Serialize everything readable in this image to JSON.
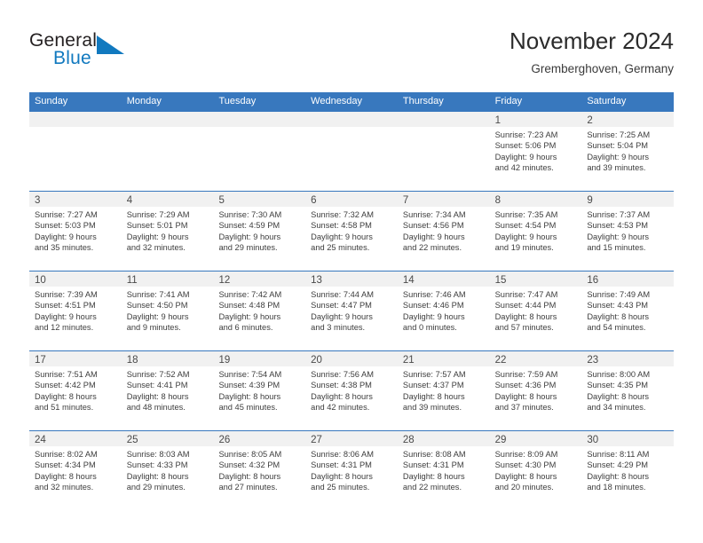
{
  "brand": {
    "name_part1": "General",
    "name_part2": "Blue",
    "accent_color": "#1179bf"
  },
  "header": {
    "title": "November 2024",
    "location": "Gremberghoven, Germany"
  },
  "theme": {
    "header_blue": "#3878be",
    "day_band_gray": "#f1f1f1",
    "text_color": "#3d3d3d"
  },
  "weekdays": [
    "Sunday",
    "Monday",
    "Tuesday",
    "Wednesday",
    "Thursday",
    "Friday",
    "Saturday"
  ],
  "weeks": [
    [
      {
        "day": "",
        "sunrise": "",
        "sunset": "",
        "daylight1": "",
        "daylight2": ""
      },
      {
        "day": "",
        "sunrise": "",
        "sunset": "",
        "daylight1": "",
        "daylight2": ""
      },
      {
        "day": "",
        "sunrise": "",
        "sunset": "",
        "daylight1": "",
        "daylight2": ""
      },
      {
        "day": "",
        "sunrise": "",
        "sunset": "",
        "daylight1": "",
        "daylight2": ""
      },
      {
        "day": "",
        "sunrise": "",
        "sunset": "",
        "daylight1": "",
        "daylight2": ""
      },
      {
        "day": "1",
        "sunrise": "Sunrise: 7:23 AM",
        "sunset": "Sunset: 5:06 PM",
        "daylight1": "Daylight: 9 hours",
        "daylight2": "and 42 minutes."
      },
      {
        "day": "2",
        "sunrise": "Sunrise: 7:25 AM",
        "sunset": "Sunset: 5:04 PM",
        "daylight1": "Daylight: 9 hours",
        "daylight2": "and 39 minutes."
      }
    ],
    [
      {
        "day": "3",
        "sunrise": "Sunrise: 7:27 AM",
        "sunset": "Sunset: 5:03 PM",
        "daylight1": "Daylight: 9 hours",
        "daylight2": "and 35 minutes."
      },
      {
        "day": "4",
        "sunrise": "Sunrise: 7:29 AM",
        "sunset": "Sunset: 5:01 PM",
        "daylight1": "Daylight: 9 hours",
        "daylight2": "and 32 minutes."
      },
      {
        "day": "5",
        "sunrise": "Sunrise: 7:30 AM",
        "sunset": "Sunset: 4:59 PM",
        "daylight1": "Daylight: 9 hours",
        "daylight2": "and 29 minutes."
      },
      {
        "day": "6",
        "sunrise": "Sunrise: 7:32 AM",
        "sunset": "Sunset: 4:58 PM",
        "daylight1": "Daylight: 9 hours",
        "daylight2": "and 25 minutes."
      },
      {
        "day": "7",
        "sunrise": "Sunrise: 7:34 AM",
        "sunset": "Sunset: 4:56 PM",
        "daylight1": "Daylight: 9 hours",
        "daylight2": "and 22 minutes."
      },
      {
        "day": "8",
        "sunrise": "Sunrise: 7:35 AM",
        "sunset": "Sunset: 4:54 PM",
        "daylight1": "Daylight: 9 hours",
        "daylight2": "and 19 minutes."
      },
      {
        "day": "9",
        "sunrise": "Sunrise: 7:37 AM",
        "sunset": "Sunset: 4:53 PM",
        "daylight1": "Daylight: 9 hours",
        "daylight2": "and 15 minutes."
      }
    ],
    [
      {
        "day": "10",
        "sunrise": "Sunrise: 7:39 AM",
        "sunset": "Sunset: 4:51 PM",
        "daylight1": "Daylight: 9 hours",
        "daylight2": "and 12 minutes."
      },
      {
        "day": "11",
        "sunrise": "Sunrise: 7:41 AM",
        "sunset": "Sunset: 4:50 PM",
        "daylight1": "Daylight: 9 hours",
        "daylight2": "and 9 minutes."
      },
      {
        "day": "12",
        "sunrise": "Sunrise: 7:42 AM",
        "sunset": "Sunset: 4:48 PM",
        "daylight1": "Daylight: 9 hours",
        "daylight2": "and 6 minutes."
      },
      {
        "day": "13",
        "sunrise": "Sunrise: 7:44 AM",
        "sunset": "Sunset: 4:47 PM",
        "daylight1": "Daylight: 9 hours",
        "daylight2": "and 3 minutes."
      },
      {
        "day": "14",
        "sunrise": "Sunrise: 7:46 AM",
        "sunset": "Sunset: 4:46 PM",
        "daylight1": "Daylight: 9 hours",
        "daylight2": "and 0 minutes."
      },
      {
        "day": "15",
        "sunrise": "Sunrise: 7:47 AM",
        "sunset": "Sunset: 4:44 PM",
        "daylight1": "Daylight: 8 hours",
        "daylight2": "and 57 minutes."
      },
      {
        "day": "16",
        "sunrise": "Sunrise: 7:49 AM",
        "sunset": "Sunset: 4:43 PM",
        "daylight1": "Daylight: 8 hours",
        "daylight2": "and 54 minutes."
      }
    ],
    [
      {
        "day": "17",
        "sunrise": "Sunrise: 7:51 AM",
        "sunset": "Sunset: 4:42 PM",
        "daylight1": "Daylight: 8 hours",
        "daylight2": "and 51 minutes."
      },
      {
        "day": "18",
        "sunrise": "Sunrise: 7:52 AM",
        "sunset": "Sunset: 4:41 PM",
        "daylight1": "Daylight: 8 hours",
        "daylight2": "and 48 minutes."
      },
      {
        "day": "19",
        "sunrise": "Sunrise: 7:54 AM",
        "sunset": "Sunset: 4:39 PM",
        "daylight1": "Daylight: 8 hours",
        "daylight2": "and 45 minutes."
      },
      {
        "day": "20",
        "sunrise": "Sunrise: 7:56 AM",
        "sunset": "Sunset: 4:38 PM",
        "daylight1": "Daylight: 8 hours",
        "daylight2": "and 42 minutes."
      },
      {
        "day": "21",
        "sunrise": "Sunrise: 7:57 AM",
        "sunset": "Sunset: 4:37 PM",
        "daylight1": "Daylight: 8 hours",
        "daylight2": "and 39 minutes."
      },
      {
        "day": "22",
        "sunrise": "Sunrise: 7:59 AM",
        "sunset": "Sunset: 4:36 PM",
        "daylight1": "Daylight: 8 hours",
        "daylight2": "and 37 minutes."
      },
      {
        "day": "23",
        "sunrise": "Sunrise: 8:00 AM",
        "sunset": "Sunset: 4:35 PM",
        "daylight1": "Daylight: 8 hours",
        "daylight2": "and 34 minutes."
      }
    ],
    [
      {
        "day": "24",
        "sunrise": "Sunrise: 8:02 AM",
        "sunset": "Sunset: 4:34 PM",
        "daylight1": "Daylight: 8 hours",
        "daylight2": "and 32 minutes."
      },
      {
        "day": "25",
        "sunrise": "Sunrise: 8:03 AM",
        "sunset": "Sunset: 4:33 PM",
        "daylight1": "Daylight: 8 hours",
        "daylight2": "and 29 minutes."
      },
      {
        "day": "26",
        "sunrise": "Sunrise: 8:05 AM",
        "sunset": "Sunset: 4:32 PM",
        "daylight1": "Daylight: 8 hours",
        "daylight2": "and 27 minutes."
      },
      {
        "day": "27",
        "sunrise": "Sunrise: 8:06 AM",
        "sunset": "Sunset: 4:31 PM",
        "daylight1": "Daylight: 8 hours",
        "daylight2": "and 25 minutes."
      },
      {
        "day": "28",
        "sunrise": "Sunrise: 8:08 AM",
        "sunset": "Sunset: 4:31 PM",
        "daylight1": "Daylight: 8 hours",
        "daylight2": "and 22 minutes."
      },
      {
        "day": "29",
        "sunrise": "Sunrise: 8:09 AM",
        "sunset": "Sunset: 4:30 PM",
        "daylight1": "Daylight: 8 hours",
        "daylight2": "and 20 minutes."
      },
      {
        "day": "30",
        "sunrise": "Sunrise: 8:11 AM",
        "sunset": "Sunset: 4:29 PM",
        "daylight1": "Daylight: 8 hours",
        "daylight2": "and 18 minutes."
      }
    ]
  ]
}
